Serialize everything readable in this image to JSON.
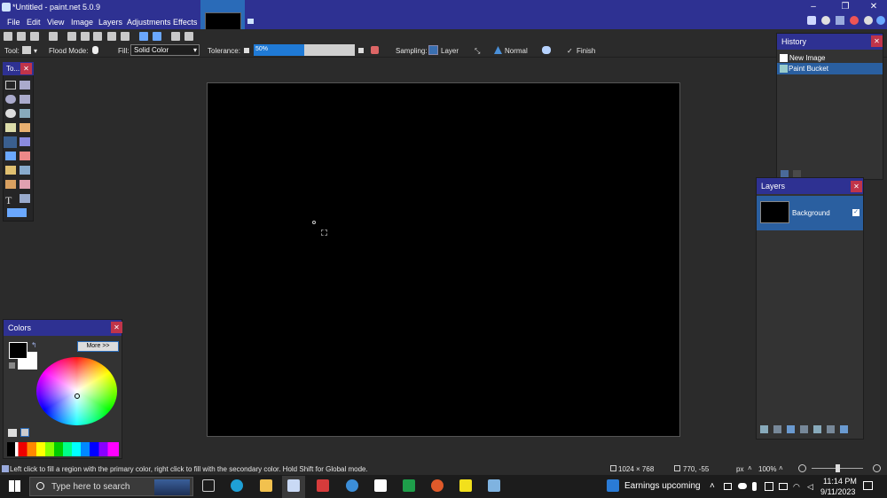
{
  "window": {
    "title": "*Untitled - paint.net 5.0.9",
    "controls": [
      "–",
      "❐",
      "✕"
    ]
  },
  "menu": [
    "File",
    "Edit",
    "View",
    "Image",
    "Layers",
    "Adjustments",
    "Effects"
  ],
  "toolbar2": {
    "tool_label": "Tool:",
    "flood_mode_label": "Flood Mode:",
    "fill_label": "Fill:",
    "fill_value": "Solid Color",
    "tolerance_label": "Tolerance:",
    "tolerance_value": "50%",
    "sampling_label": "Sampling:",
    "sampling_value": "Layer",
    "blend_value": "Normal",
    "finish_label": "Finish"
  },
  "tools_panel": {
    "title": "To..."
  },
  "history": {
    "title": "History",
    "items": [
      "New Image",
      "Paint Bucket"
    ]
  },
  "layers": {
    "title": "Layers",
    "items": [
      "Background"
    ]
  },
  "colors": {
    "title": "Colors",
    "more_label": "More >>"
  },
  "statusbar": {
    "hint": "Left click to fill a region with the primary color, right click to fill with the secondary color. Hold Shift for Global mode.",
    "image_size": "1024 × 768",
    "cursor_pos": "770, -55",
    "units": "px",
    "zoom": "100%"
  },
  "taskbar": {
    "search_placeholder": "Type here to search",
    "news": "Earnings upcoming",
    "time": "11:14 PM",
    "date": "9/11/2023"
  },
  "colors_accent": {
    "titlebar": "#2e3192",
    "selection": "#1f7ad6",
    "close": "#c0344a"
  }
}
